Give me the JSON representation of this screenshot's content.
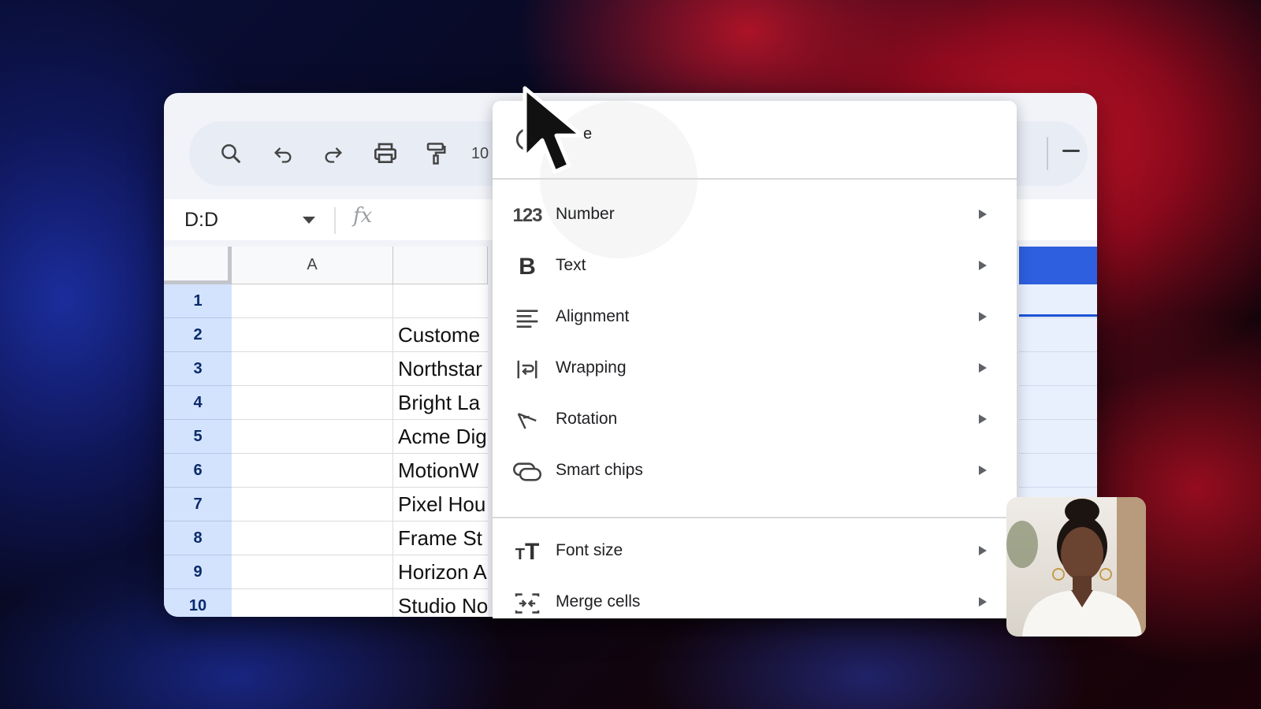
{
  "toolbar": {
    "zoom_partial": "10"
  },
  "formula_bar": {
    "name_box": "D:D",
    "fx_label": "fx"
  },
  "columns": [
    "A"
  ],
  "rows": [
    {
      "num": "1",
      "b": ""
    },
    {
      "num": "2",
      "b": "Custome"
    },
    {
      "num": "3",
      "b": "Northstar"
    },
    {
      "num": "4",
      "b": "Bright La"
    },
    {
      "num": "5",
      "b": "Acme Dig"
    },
    {
      "num": "6",
      "b": "MotionW"
    },
    {
      "num": "7",
      "b": "Pixel Hou"
    },
    {
      "num": "8",
      "b": "Frame St"
    },
    {
      "num": "9",
      "b": "Horizon A"
    },
    {
      "num": "10",
      "b": "Studio No"
    }
  ],
  "context_menu": {
    "top_item_partial": "e",
    "items": [
      {
        "label": "Number",
        "icon": "number-format-icon"
      },
      {
        "label": "Text",
        "icon": "bold-icon"
      },
      {
        "label": "Alignment",
        "icon": "align-left-icon"
      },
      {
        "label": "Wrapping",
        "icon": "text-wrap-icon"
      },
      {
        "label": "Rotation",
        "icon": "text-rotation-icon"
      },
      {
        "label": "Smart chips",
        "icon": "smart-chip-icon"
      },
      {
        "label": "Font size",
        "icon": "font-size-icon"
      },
      {
        "label": "Merge cells",
        "icon": "merge-cells-icon"
      }
    ]
  },
  "colors": {
    "selected_header": "#2e5fde",
    "row_header": "#d3e3fd"
  }
}
